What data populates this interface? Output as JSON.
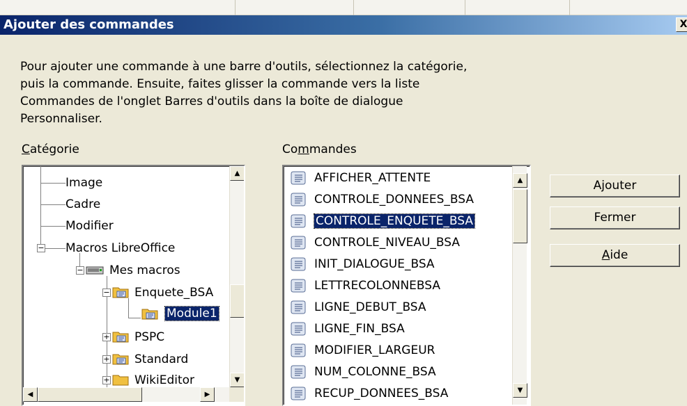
{
  "dialog": {
    "title": "Ajouter des commandes",
    "close_glyph": "X",
    "description": "Pour ajouter une commande à une barre d'outils, sélectionnez la catégorie, puis la commande. Ensuite, faites glisser la commande vers la liste Commandes de l'onglet Barres d'outils dans la boîte de dialogue Personnaliser.",
    "description_lines": [
      "Pour ajouter une commande à une barre d'outils, sélectionnez la catégorie,",
      "puis la commande. Ensuite, faites glisser la commande vers la liste",
      "Commandes de l'onglet Barres d'outils dans la boîte de dialogue",
      "Personnaliser."
    ]
  },
  "category": {
    "label_mnemonic": "C",
    "label_rest": "atégorie",
    "items": [
      {
        "label": "Image",
        "expander": ""
      },
      {
        "label": "Cadre",
        "expander": ""
      },
      {
        "label": "Modifier",
        "expander": ""
      },
      {
        "label": "Macros LibreOffice",
        "expander": "−"
      },
      {
        "label": "Mes macros",
        "expander": "−"
      },
      {
        "label": "Enquete_BSA",
        "expander": "−"
      },
      {
        "label": "Module1",
        "expander": "",
        "selected": true
      },
      {
        "label": "PSPC",
        "expander": "+"
      },
      {
        "label": "Standard",
        "expander": "+"
      },
      {
        "label": "WikiEditor",
        "expander": "+"
      }
    ]
  },
  "commands": {
    "label_prefix": "Co",
    "label_mnemonic": "m",
    "label_rest": "mandes",
    "items": [
      "AFFICHER_ATTENTE",
      "CONTROLE_DONNEES_BSA",
      "CONTROLE_ENQUETE_BSA",
      "CONTROLE_NIVEAU_BSA",
      "INIT_DIALOGUE_BSA",
      "LETTRECOLONNEBSA",
      "LIGNE_DEBUT_BSA",
      "LIGNE_FIN_BSA",
      "MODIFIER_LARGEUR",
      "NUM_COLONNE_BSA",
      "RECUP_DONNEES_BSA"
    ],
    "selected_index": 2
  },
  "buttons": {
    "add": "Ajouter",
    "close": "Fermer",
    "help_mnemonic": "A",
    "help_rest": "ide"
  },
  "colors": {
    "titlebar_start": "#0a246a",
    "titlebar_end": "#a6caf0",
    "selection": "#0a246a",
    "face": "#ece9d8"
  }
}
